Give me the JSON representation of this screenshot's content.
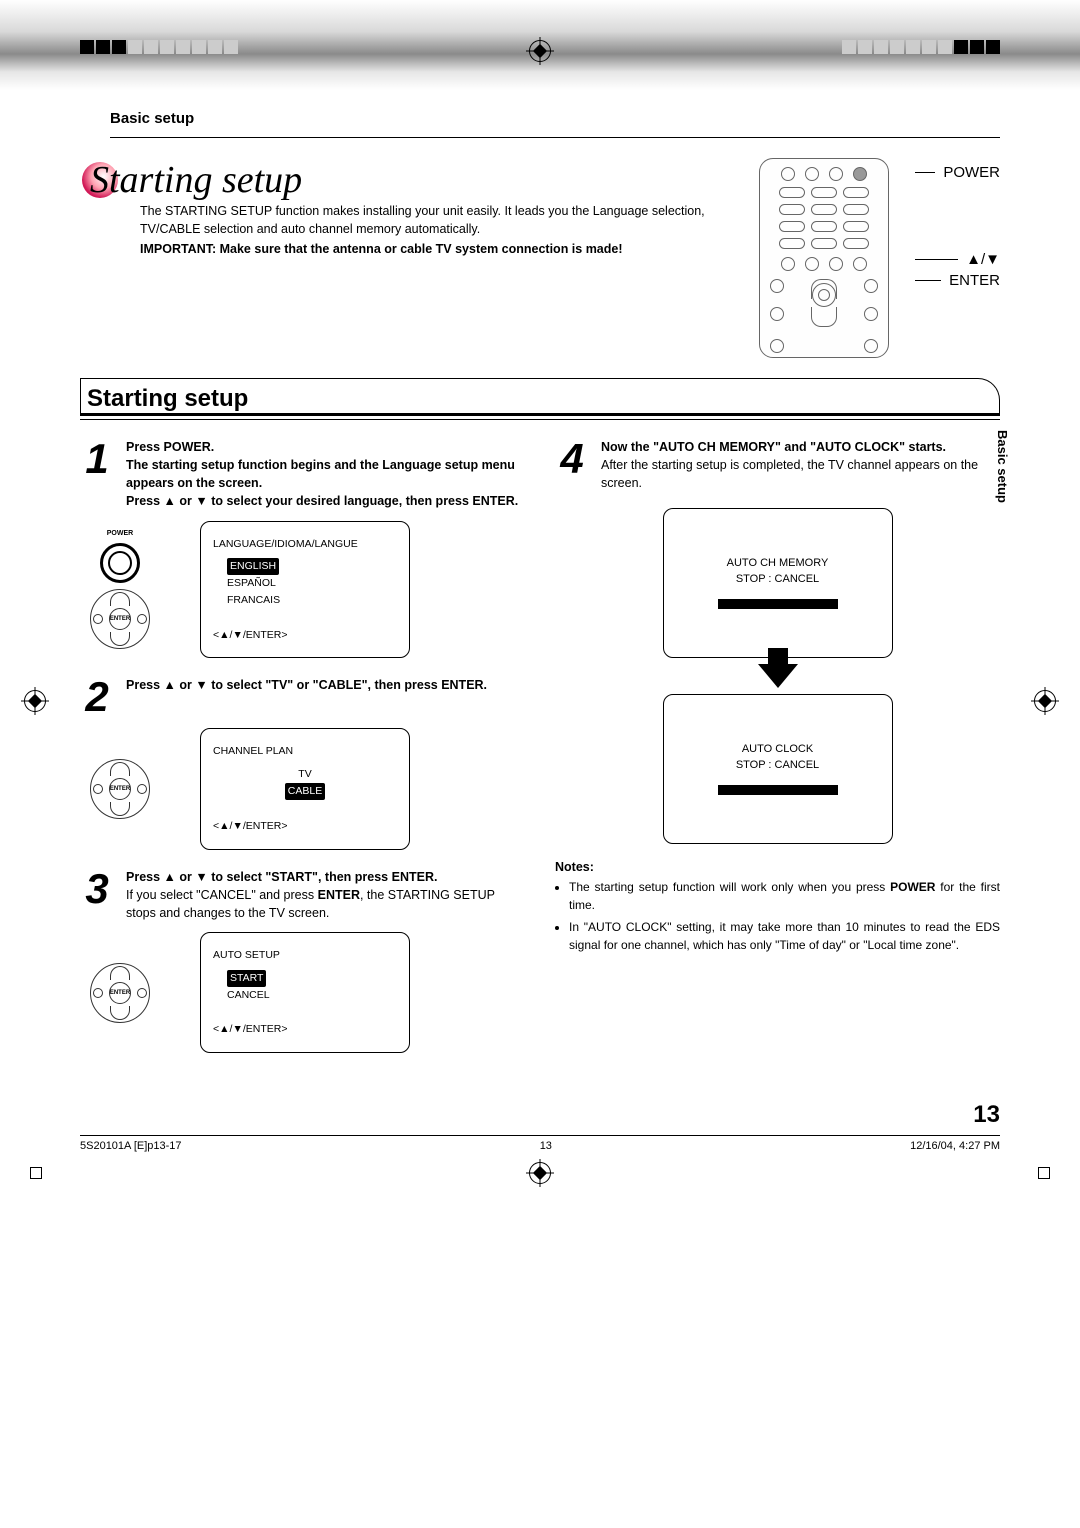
{
  "header": {
    "chapter": "Basic setup"
  },
  "title": "Starting setup",
  "intro": {
    "p1": "The STARTING SETUP function makes installing your unit easily. It leads you the Language selection, TV/CABLE selection and auto channel memory automatically.",
    "p2": "IMPORTANT: Make sure that the antenna or cable TV system connection is made!"
  },
  "remote_labels": {
    "power": "POWER",
    "updown": "▲/▼",
    "enter": "ENTER"
  },
  "section_title": "Starting setup",
  "side_tab": "Basic setup",
  "steps": {
    "s1": {
      "num": "1",
      "b1": "Press POWER.",
      "b2": "The starting setup function begins and the Language setup menu appears on the screen.",
      "b3": "Press ▲ or ▼ to select your desired language, then press ENTER."
    },
    "s2": {
      "num": "2",
      "b1": "Press ▲ or ▼ to select \"TV\" or \"CABLE\", then press ENTER."
    },
    "s3": {
      "num": "3",
      "b1": "Press ▲ or ▼ to select \"START\", then press ENTER.",
      "p1a": "If you select \"CANCEL\" and press ",
      "p1b": "ENTER",
      "p1c": ", the STARTING SETUP stops and changes to the TV screen."
    },
    "s4": {
      "num": "4",
      "b1": "Now the \"AUTO CH MEMORY\" and \"AUTO CLOCK\" starts.",
      "p1": "After the starting setup is completed, the TV channel appears on the screen."
    }
  },
  "osd": {
    "screen1": {
      "title": "LANGUAGE/IDIOMA/LANGUE",
      "opt_hl": "ENGLISH",
      "opt2": "ESPAÑOL",
      "opt3": "FRANCAIS",
      "foot": "<▲/▼/ENTER>"
    },
    "screen2": {
      "title": "CHANNEL PLAN",
      "opt1": "TV",
      "opt_hl": "CABLE",
      "foot": "<▲/▼/ENTER>"
    },
    "screen3": {
      "title": "AUTO SETUP",
      "opt_hl": "START",
      "opt2": "CANCEL",
      "foot": "<▲/▼/ENTER>"
    },
    "tv1": {
      "l1": "AUTO CH MEMORY",
      "l2": "STOP : CANCEL"
    },
    "tv2": {
      "l1": "AUTO CLOCK",
      "l2": "STOP : CANCEL"
    }
  },
  "controls": {
    "power_label": "POWER",
    "enter_label": "ENTER"
  },
  "notes": {
    "header": "Notes:",
    "n1a": "The starting setup function will work only when you press ",
    "n1b": "POWER",
    "n1c": " for the first time.",
    "n2": "In \"AUTO CLOCK\" setting, it may take more than 10 minutes to read the EDS signal for one channel, which has only \"Time of day\" or \"Local time zone\"."
  },
  "page_number": "13",
  "footer": {
    "left": "5S20101A [E]p13-17",
    "center": "13",
    "right": "12/16/04, 4:27 PM"
  }
}
